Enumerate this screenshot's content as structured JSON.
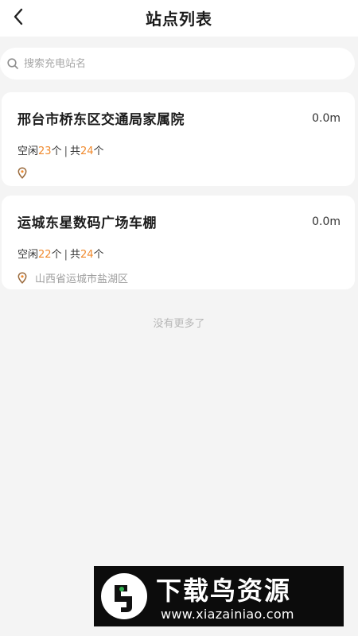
{
  "header": {
    "title": "站点列表"
  },
  "search": {
    "placeholder": "搜索充电站名",
    "value": ""
  },
  "stations": [
    {
      "name": "邢台市桥东区交通局家属院",
      "distance": "0.0m",
      "idle_label": "空闲",
      "idle_count": "23",
      "unit": "个",
      "separator": "|",
      "total_label": "共",
      "total_count": "24",
      "address": ""
    },
    {
      "name": "运城东星数码广场车棚",
      "distance": "0.0m",
      "idle_label": "空闲",
      "idle_count": "22",
      "unit": "个",
      "separator": "|",
      "total_label": "共",
      "total_count": "24",
      "address": "山西省运城市盐湖区"
    }
  ],
  "footer": {
    "no_more": "没有更多了"
  },
  "watermark": {
    "title": "下载鸟资源",
    "url": "www.xiazainiao.com"
  },
  "colors": {
    "accent": "#f08a2e",
    "background": "#f4f4f4",
    "card": "#ffffff"
  },
  "icons": {
    "back": "chevron-left-icon",
    "search": "search-icon",
    "location": "location-pin-icon"
  }
}
